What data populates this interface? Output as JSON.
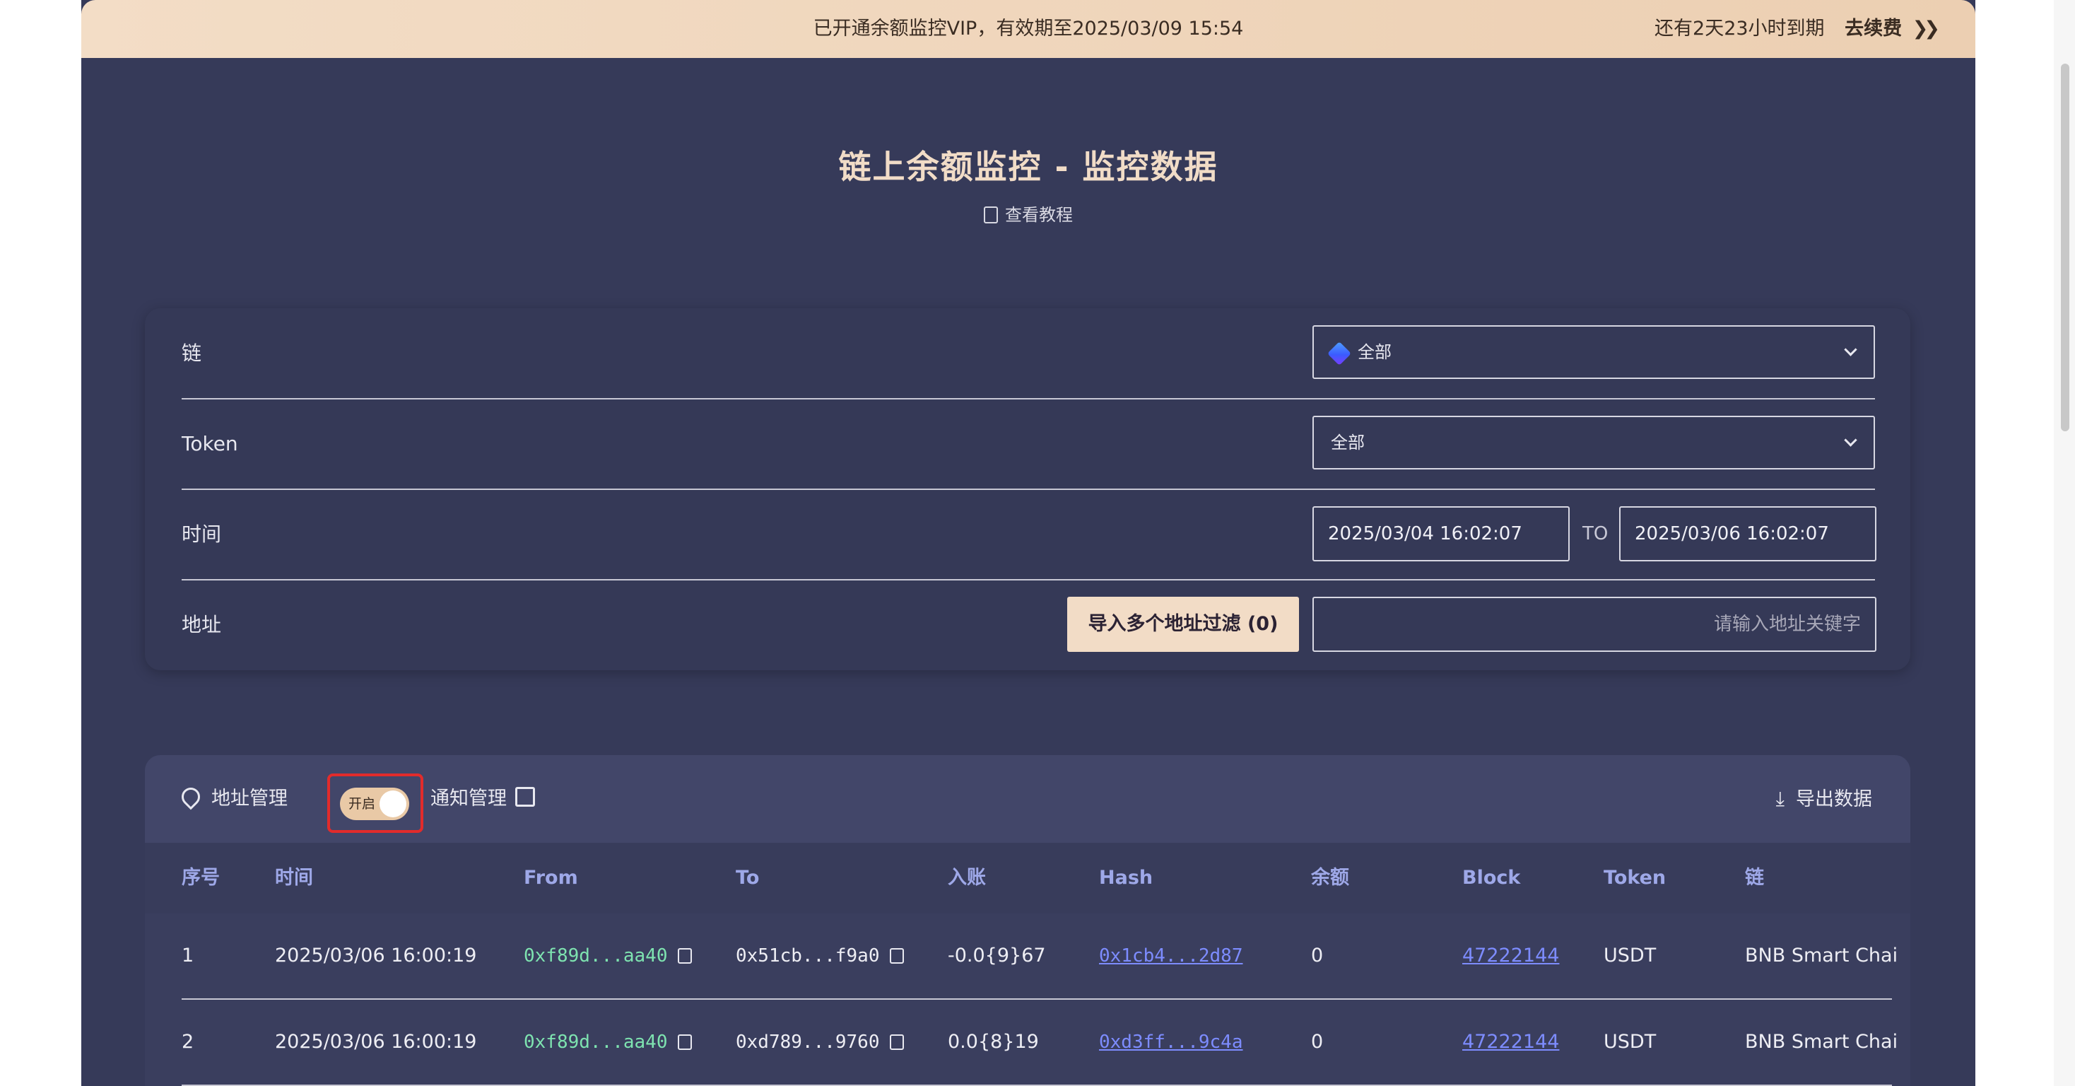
{
  "banner": {
    "vip_text": "已开通余额监控VIP，有效期至2025/03/09 15:54",
    "remaining": "还有2天23小时到期",
    "renew": "去续费",
    "renew_icon": "double-chevron-right-icon"
  },
  "header": {
    "title": "链上余额监控 - 监控数据",
    "tutorial": "查看教程"
  },
  "filters": {
    "chain_label": "链",
    "chain_value": "全部",
    "token_label": "Token",
    "token_value": "全部",
    "time_label": "时间",
    "time_from": "2025/03/04 16:02:07",
    "time_to_label": "TO",
    "time_to": "2025/03/06 16:02:07",
    "address_label": "地址",
    "import_button": "导入多个地址过滤 (0)",
    "address_placeholder": "请输入地址关键字"
  },
  "toolbar": {
    "address_mgmt": "地址管理",
    "switch_label": "开启",
    "notify_mgmt": "通知管理",
    "export": "导出数据"
  },
  "table": {
    "headers": [
      "序号",
      "时间",
      "From",
      "To",
      "入账",
      "Hash",
      "余额",
      "Block",
      "Token",
      "链"
    ],
    "rows": [
      {
        "no": "1",
        "time": "2025/03/06 16:00:19",
        "from": "0xf89d...aa40",
        "to": "0x51cb...f9a0",
        "amount": "-0.0{9}67",
        "hash": "0x1cb4...2d87",
        "balance": "0",
        "block": "47222144",
        "token": "USDT",
        "chain": "BNB Smart Chai"
      },
      {
        "no": "2",
        "time": "2025/03/06 16:00:19",
        "from": "0xf89d...aa40",
        "to": "0xd789...9760",
        "amount": "0.0{8}19",
        "hash": "0xd3ff...9c4a",
        "balance": "0",
        "block": "47222144",
        "token": "USDT",
        "chain": "BNB Smart Chai"
      }
    ]
  }
}
